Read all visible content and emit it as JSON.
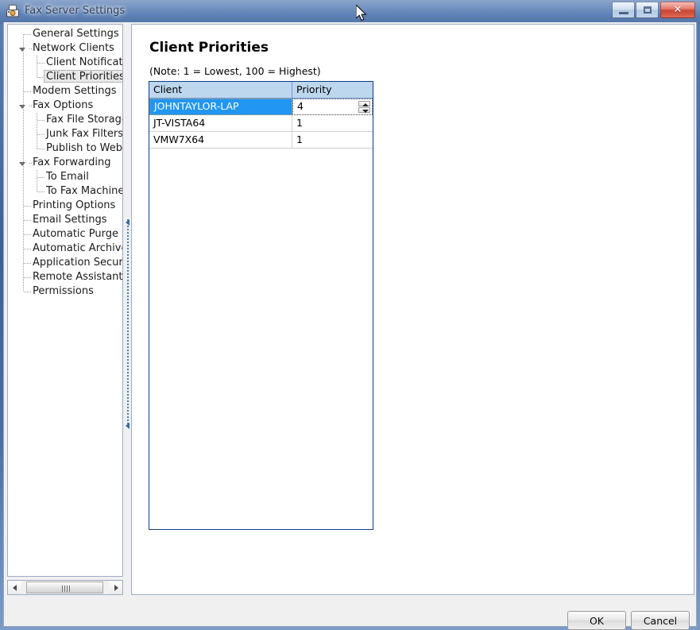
{
  "window": {
    "title": "Fax Server Settings",
    "icon": "fax-machine-icon",
    "controls": {
      "minimize_label": "—",
      "maximize_label": "□",
      "close_label": "✕"
    }
  },
  "sidebar": {
    "items": [
      {
        "label": "General Settings",
        "level": 1,
        "expandable": false,
        "selected": false
      },
      {
        "label": "Network Clients",
        "level": 1,
        "expandable": true,
        "selected": false
      },
      {
        "label": "Client Notification",
        "level": 2,
        "expandable": false,
        "selected": false
      },
      {
        "label": "Client Priorities",
        "level": 2,
        "expandable": false,
        "selected": true
      },
      {
        "label": "Modem Settings",
        "level": 1,
        "expandable": false,
        "selected": false
      },
      {
        "label": "Fax Options",
        "level": 1,
        "expandable": true,
        "selected": false
      },
      {
        "label": "Fax File Storage",
        "level": 2,
        "expandable": false,
        "selected": false
      },
      {
        "label": "Junk Fax Filters",
        "level": 2,
        "expandable": false,
        "selected": false
      },
      {
        "label": "Publish to Web",
        "level": 2,
        "expandable": false,
        "selected": false
      },
      {
        "label": "Fax Forwarding",
        "level": 1,
        "expandable": true,
        "selected": false
      },
      {
        "label": "To Email",
        "level": 2,
        "expandable": false,
        "selected": false
      },
      {
        "label": "To Fax Machines",
        "level": 2,
        "expandable": false,
        "selected": false
      },
      {
        "label": "Printing Options",
        "level": 1,
        "expandable": false,
        "selected": false
      },
      {
        "label": "Email Settings",
        "level": 1,
        "expandable": false,
        "selected": false
      },
      {
        "label": "Automatic Purge",
        "level": 1,
        "expandable": false,
        "selected": false
      },
      {
        "label": "Automatic Archive",
        "level": 1,
        "expandable": false,
        "selected": false
      },
      {
        "label": "Application Security",
        "level": 1,
        "expandable": false,
        "selected": false
      },
      {
        "label": "Remote Assistant",
        "level": 1,
        "expandable": false,
        "selected": false
      },
      {
        "label": "Permissions",
        "level": 1,
        "expandable": false,
        "selected": false
      }
    ],
    "hscroll": {
      "left_arrow": "scroll-left-icon",
      "right_arrow": "scroll-right-icon"
    }
  },
  "main": {
    "title": "Client Priorities",
    "note": "(Note: 1 = Lowest, 100 = Highest)",
    "grid": {
      "columns": [
        "Client",
        "Priority"
      ],
      "rows": [
        {
          "client": "JOHNTAYLOR-LAP",
          "priority": "4",
          "selected": true
        },
        {
          "client": "JT-VISTA64",
          "priority": "1",
          "selected": false
        },
        {
          "client": "VMW7X64",
          "priority": "1",
          "selected": false
        }
      ],
      "editor": {
        "active": true,
        "value": "4",
        "spinner_up": "spinner-up-icon",
        "spinner_down": "spinner-down-icon"
      }
    }
  },
  "footer": {
    "ok_label": "OK",
    "cancel_label": "Cancel"
  },
  "colors": {
    "header_bg": "#bdd7ee",
    "selection_bg": "#2196f3",
    "grid_border": "#0d3b87",
    "focus_border": "#d6a05a",
    "titlebar": "#4a6fa8",
    "close_button": "#c22f1c"
  }
}
